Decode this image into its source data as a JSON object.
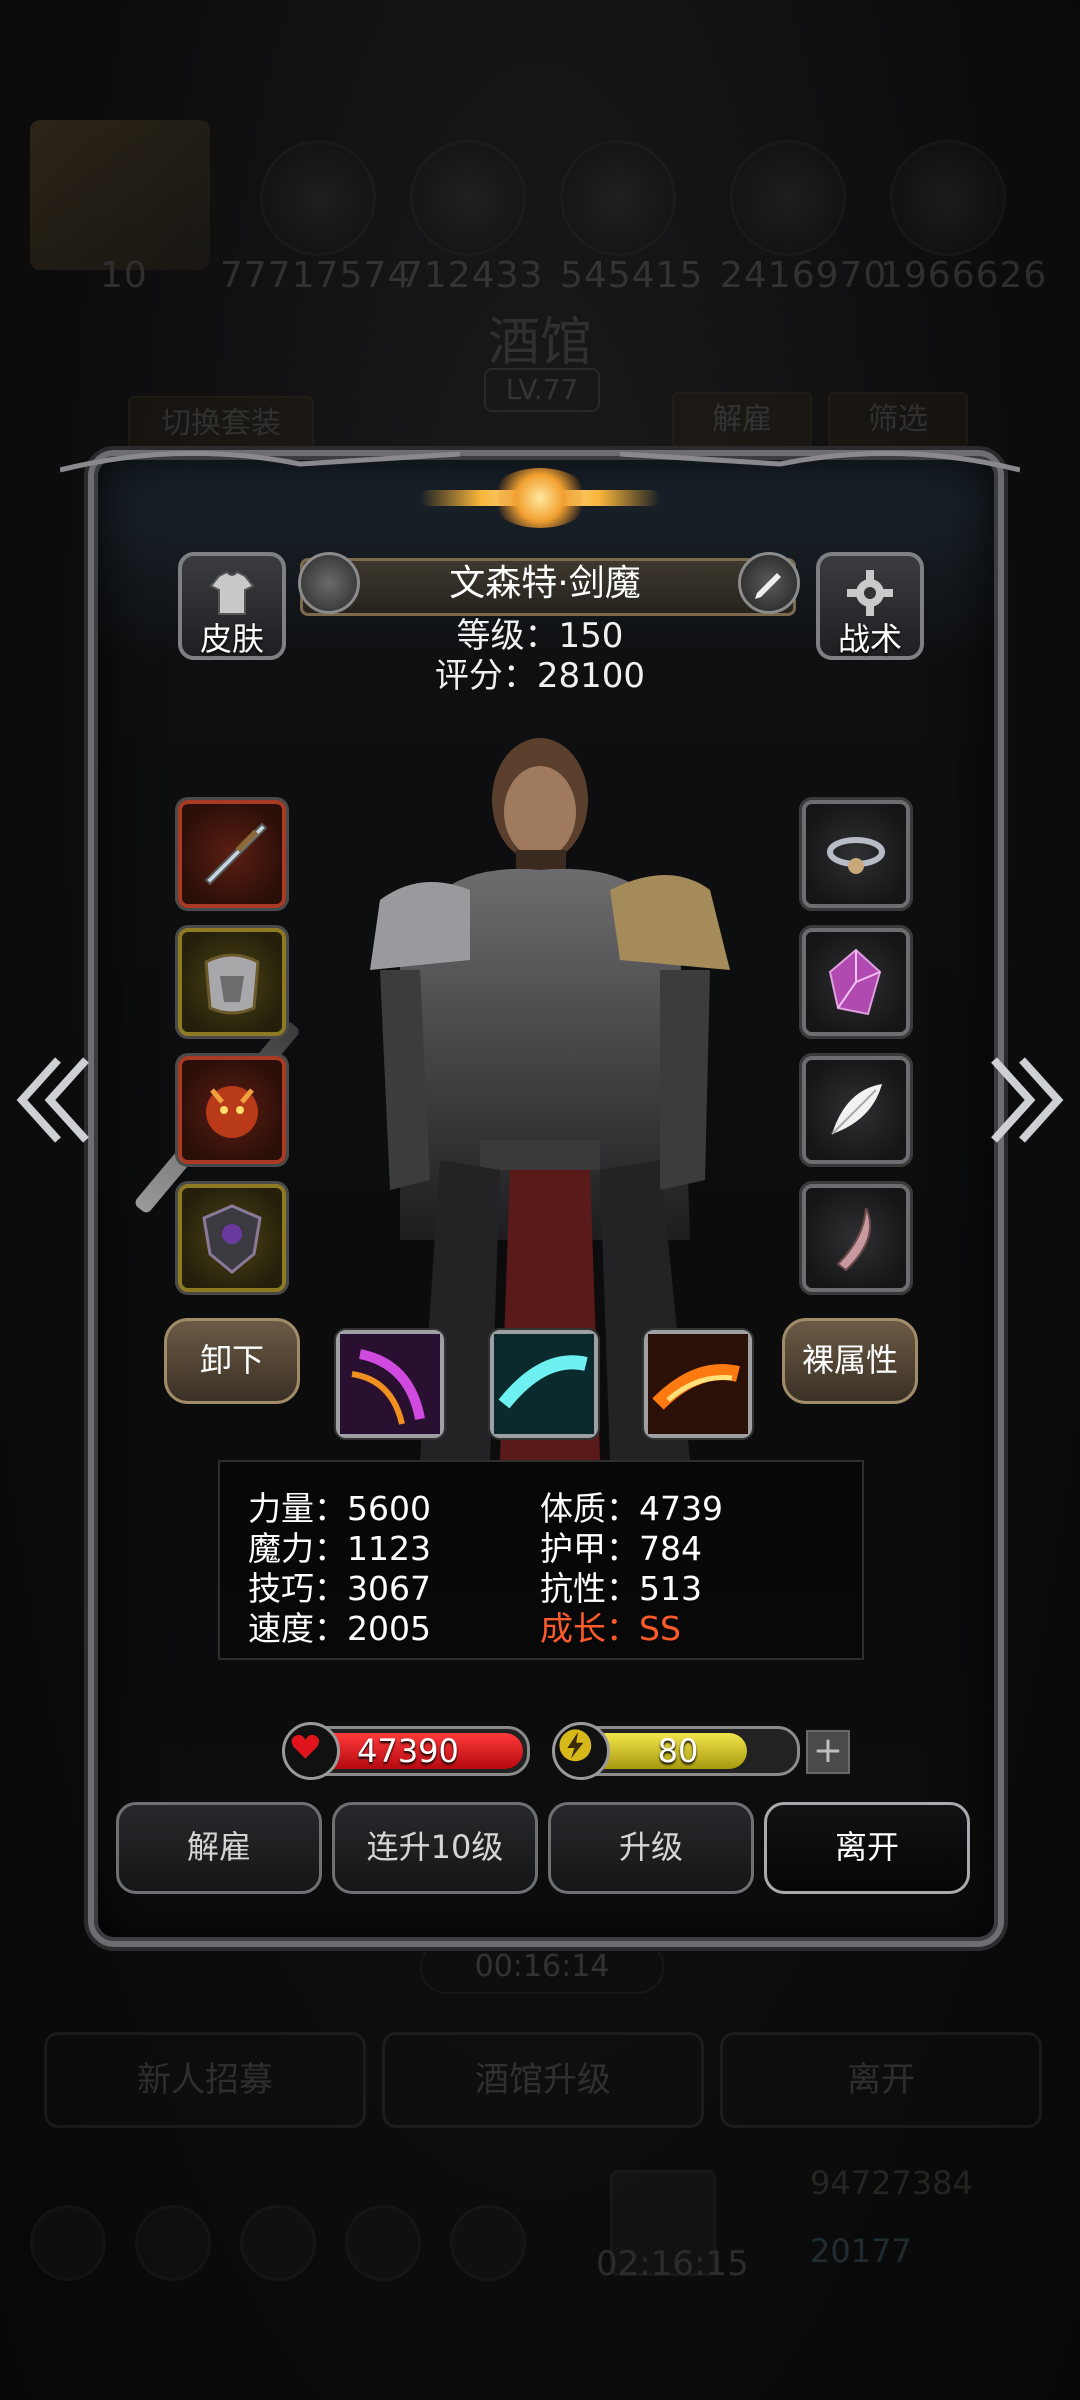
{
  "background": {
    "top_numbers": [
      "10",
      "77717574",
      "712433",
      "545415",
      "2416970",
      "1966626"
    ],
    "title": "酒馆",
    "level_badge": "LV.77",
    "switch_outfit": "切换套装",
    "dismiss": "解雇",
    "filter": "筛选",
    "timer": "00:16:14",
    "bottom_buttons": [
      "新人招募",
      "酒馆升级",
      "离开"
    ],
    "chest_timer": "02:16:15",
    "currency_gold": "94727384",
    "currency_gems": "20177"
  },
  "hero": {
    "name": "文森特·剑魔",
    "level_text": "等级：150",
    "score_text": "评分：28100",
    "skin_label": "皮肤",
    "tactics_label": "战术"
  },
  "equipment": {
    "left": [
      {
        "icon": "sword-icon",
        "rarity": "red"
      },
      {
        "icon": "armor-icon",
        "rarity": "gold"
      },
      {
        "icon": "demon-orb-icon",
        "rarity": "red"
      },
      {
        "icon": "dark-shield-icon",
        "rarity": "gold"
      }
    ],
    "right": [
      {
        "icon": "ring-icon",
        "rarity": "gray"
      },
      {
        "icon": "crystal-icon",
        "rarity": "gray"
      },
      {
        "icon": "feather-icon",
        "rarity": "gray"
      },
      {
        "icon": "claw-icon",
        "rarity": "gray"
      }
    ]
  },
  "actions": {
    "unequip": "卸下",
    "base_attributes": "裸属性"
  },
  "skills": [
    "purple-slash-icon",
    "cyan-slash-icon",
    "fire-slash-icon"
  ],
  "stats": {
    "strength": "力量：5600",
    "magic": "魔力：1123",
    "skill": "技巧：3067",
    "speed": "速度：2005",
    "constitution": "体质：4739",
    "armor": "护甲：784",
    "resistance": "抗性：513",
    "growth": "成长：SS"
  },
  "bars": {
    "hp": "47390",
    "energy": "80",
    "energy_fill_percent": 80,
    "plus": "+"
  },
  "bottom": {
    "dismiss": "解雇",
    "level10": "连升10级",
    "upgrade": "升级",
    "leave": "离开"
  },
  "colors": {
    "hp": "#d8141a",
    "energy": "#d6c21a",
    "growth": "#ff5a2a"
  }
}
